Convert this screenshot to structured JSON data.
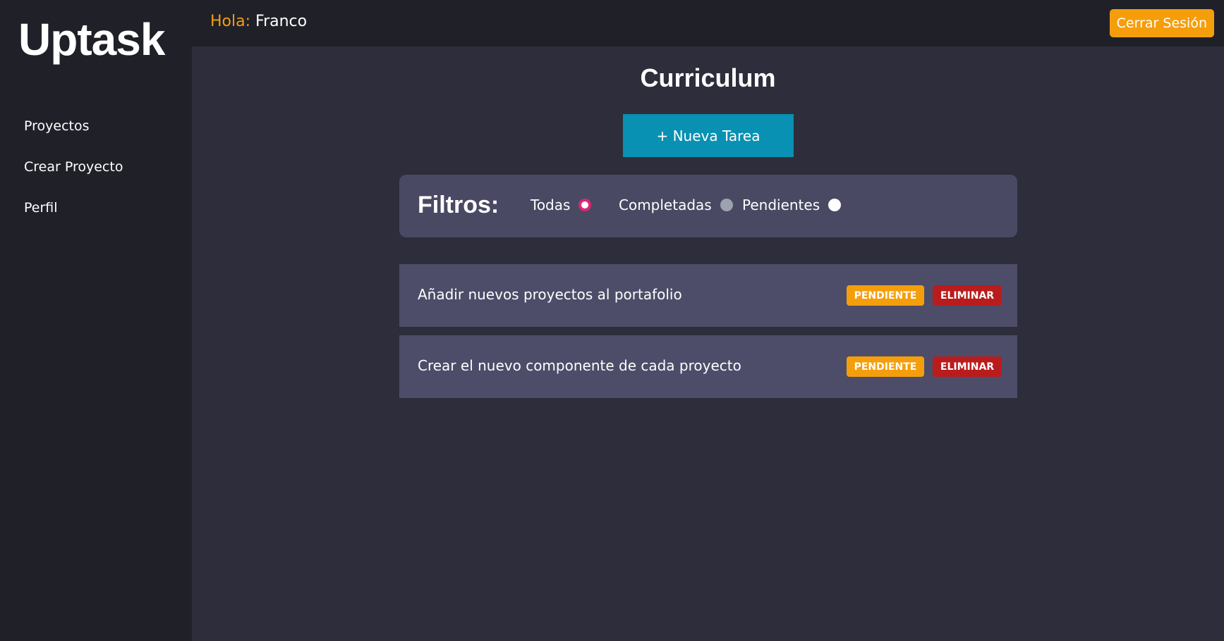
{
  "sidebar": {
    "logo": "Uptask",
    "items": [
      {
        "label": "Proyectos"
      },
      {
        "label": "Crear Proyecto"
      },
      {
        "label": "Perfil"
      }
    ]
  },
  "header": {
    "greeting_prefix": "Hola:",
    "user_name": "Franco",
    "logout_label": "Cerrar Sesión"
  },
  "main": {
    "project_title": "Curriculum",
    "new_task_label": "+ Nueva Tarea",
    "filters": {
      "label": "Filtros:",
      "options": [
        {
          "label": "Todas",
          "selected": true
        },
        {
          "label": "Completadas",
          "selected": false
        },
        {
          "label": "Pendientes",
          "selected": false
        }
      ]
    },
    "tasks": [
      {
        "text": "Añadir nuevos proyectos al portafolio",
        "status_label": "PENDIENTE",
        "delete_label": "ELIMINAR"
      },
      {
        "text": "Crear el nuevo componente de cada proyecto",
        "status_label": "PENDIENTE",
        "delete_label": "ELIMINAR"
      }
    ]
  },
  "colors": {
    "accent": "#f59e0b",
    "primary_button": "#0891b2",
    "danger": "#b91c1c",
    "sidebar_bg": "#202029",
    "main_bg": "#2d2d3b",
    "card_bg": "#4d4d69",
    "radio_selected": "#db2777"
  }
}
